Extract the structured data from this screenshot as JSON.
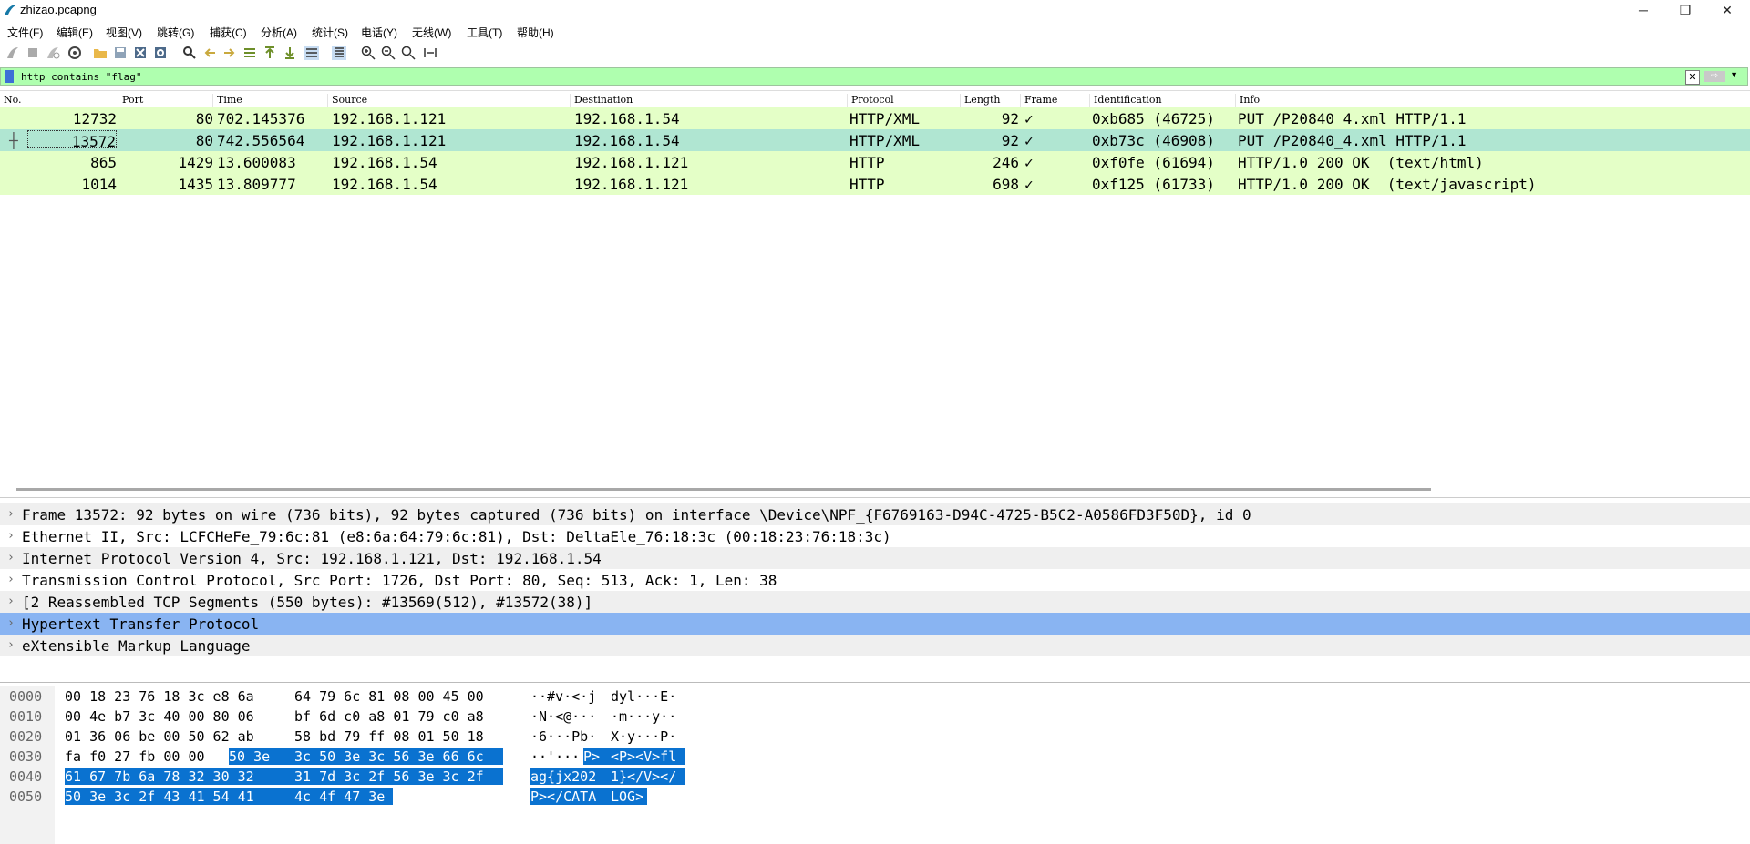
{
  "window": {
    "title": "zhizao.pcapng",
    "minimize": "─",
    "maximize": "❐",
    "close": "✕"
  },
  "menu": [
    "文件(F)",
    "编辑(E)",
    "视图(V)",
    "跳转(G)",
    "捕获(C)",
    "分析(A)",
    "统计(S)",
    "电话(Y)",
    "无线(W)",
    "工具(T)",
    "帮助(H)"
  ],
  "filter": {
    "value": "http contains \"flag\"",
    "clear_glyph": "✕",
    "apply_glyph": "⇨",
    "dropdown_glyph": "▼",
    "add_glyph": "+"
  },
  "columns": [
    "No.",
    "Port",
    "Time",
    "Source",
    "Destination",
    "Protocol",
    "Length",
    "Frame",
    "Identification",
    "Info"
  ],
  "packets": [
    {
      "no": "12732",
      "port": "80",
      "time": "702.145376",
      "src": "192.168.1.121",
      "dst": "192.168.1.54",
      "proto": "HTTP/XML",
      "len": "92",
      "frame": "✓",
      "ident": "0xb685 (46725)",
      "info": "PUT /P20840_4.xml HTTP/1.1"
    },
    {
      "no": "13572",
      "port": "80",
      "time": "742.556564",
      "src": "192.168.1.121",
      "dst": "192.168.1.54",
      "proto": "HTTP/XML",
      "len": "92",
      "frame": "✓",
      "ident": "0xb73c (46908)",
      "info": "PUT /P20840_4.xml HTTP/1.1"
    },
    {
      "no": "865",
      "port": "1429",
      "time": "13.600083",
      "src": "192.168.1.54",
      "dst": "192.168.1.121",
      "proto": "HTTP",
      "len": "246",
      "frame": "✓",
      "ident": "0xf0fe (61694)",
      "info": "HTTP/1.0 200 OK  (text/html)"
    },
    {
      "no": "1014",
      "port": "1435",
      "time": "13.809777",
      "src": "192.168.1.54",
      "dst": "192.168.1.121",
      "proto": "HTTP",
      "len": "698",
      "frame": "✓",
      "ident": "0xf125 (61733)",
      "info": "HTTP/1.0 200 OK  (text/javascript)"
    }
  ],
  "details": [
    "Frame 13572: 92 bytes on wire (736 bits), 92 bytes captured (736 bits) on interface \\Device\\NPF_{F6769163-D94C-4725-B5C2-A0586FD3F50D}, id 0",
    "Ethernet II, Src: LCFCHeFe_79:6c:81 (e8:6a:64:79:6c:81), Dst: DeltaEle_76:18:3c (00:18:23:76:18:3c)",
    "Internet Protocol Version 4, Src: 192.168.1.121, Dst: 192.168.1.54",
    "Transmission Control Protocol, Src Port: 1726, Dst Port: 80, Seq: 513, Ack: 1, Len: 38",
    "[2 Reassembled TCP Segments (550 bytes): #13569(512), #13572(38)]",
    "Hypertext Transfer Protocol",
    "eXtensible Markup Language"
  ],
  "bytes": [
    {
      "off": "0000",
      "hex": [
        "00 18 23 76 18 3c e8 6a",
        "64 79 6c 81 08 00 45 00"
      ],
      "ascii": [
        "··#v·<·j",
        "dyl···E·"
      ]
    },
    {
      "off": "0010",
      "hex": [
        "00 4e b7 3c 40 00 80 06",
        "bf 6d c0 a8 01 79 c0 a8"
      ],
      "ascii": [
        "·N·<@···",
        "·m···y··"
      ]
    },
    {
      "off": "0020",
      "hex": [
        "01 36 06 be 00 50 62 ab",
        "58 bd 79 ff 08 01 50 18"
      ],
      "ascii": [
        "·6···Pb·",
        "X·y···P·"
      ]
    },
    {
      "off": "0030",
      "hex": [
        "fa f0 27 fb 00 00 ",
        "50 3e",
        "3c 50 3e 3c 56 3e 66 6c"
      ],
      "ascii": [
        "··'···",
        "P>",
        "<P><V>fl"
      ]
    },
    {
      "off": "0040",
      "hex": [
        "61 67 7b 6a 78 32 30 32",
        "31 7d 3c 2f 56 3e 3c 2f"
      ],
      "ascii": [
        "ag{jx202",
        "1}</V></"
      ]
    },
    {
      "off": "0050",
      "hex": [
        "50 3e 3c 2f 43 41 54 41",
        "4c 4f 47 3e"
      ],
      "ascii": [
        "P></CATA",
        "LOG>"
      ]
    }
  ]
}
